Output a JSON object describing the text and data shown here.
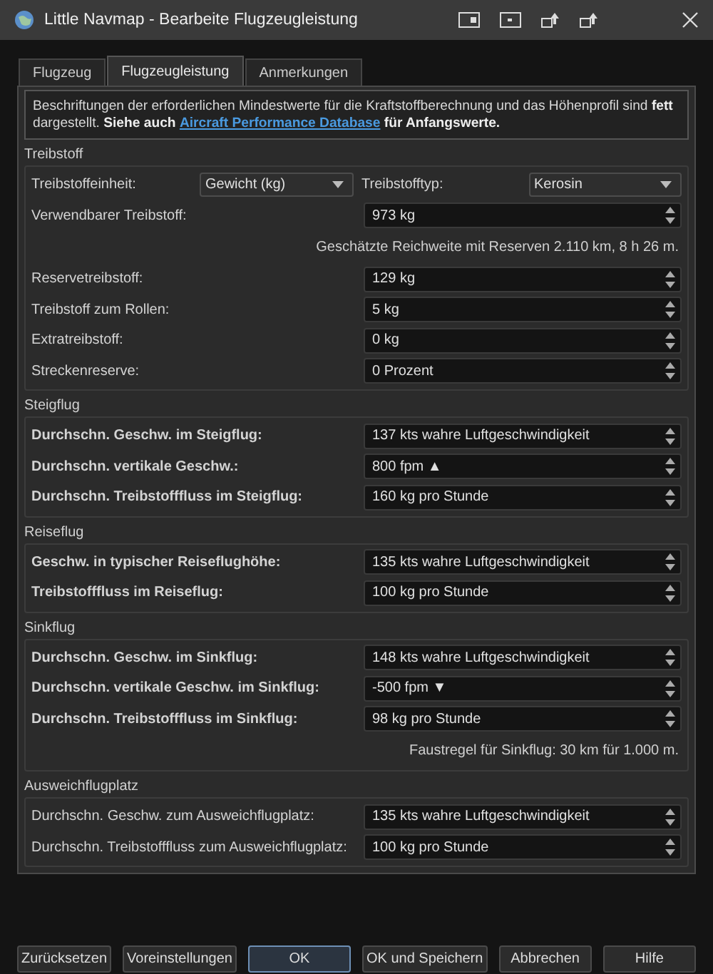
{
  "window": {
    "title": "Little Navmap - Bearbeite Flugzeugleistung"
  },
  "tabs": [
    {
      "label": "Flugzeug",
      "selected": false
    },
    {
      "label": "Flugzeugleistung",
      "selected": true
    },
    {
      "label": "Anmerkungen",
      "selected": false
    }
  ],
  "info": {
    "before": "Beschriftungen der erforderlichen Mindestwerte für die Kraftstoffberechnung und das Höhenprofil sind **fett** dargestellt. **Siehe auch**",
    "link": "Aircraft Performance Database",
    "after": "**für Anfangswerte.**"
  },
  "groups": [
    {
      "title": "Treibstoff",
      "rows": [
        {
          "kind": "combo-pair",
          "label": "Treibstoffeinheit:",
          "value": "Gewicht (kg)",
          "label2": "Treibstofftyp:",
          "value2": "Kerosin"
        },
        {
          "kind": "spin",
          "label": "Verwendbarer Treibstoff:",
          "value": "973 kg",
          "bold": false
        },
        {
          "kind": "note",
          "text": "Geschätzte Reichweite mit Reserven 2.110 km, 8 h 26 m."
        },
        {
          "kind": "spin",
          "label": "Reservetreibstoff:",
          "value": "129 kg",
          "bold": false
        },
        {
          "kind": "spin",
          "label": "Treibstoff zum Rollen:",
          "value": "5 kg",
          "bold": false
        },
        {
          "kind": "spin",
          "label": "Extratreibstoff:",
          "value": "0 kg",
          "bold": false
        },
        {
          "kind": "spin",
          "label": "Streckenreserve:",
          "value": "0 Prozent",
          "bold": false
        }
      ]
    },
    {
      "title": "Steigflug",
      "rows": [
        {
          "kind": "spin",
          "label": "Durchschn. Geschw. im Steigflug:",
          "value": "137 kts wahre Luftgeschwindigkeit",
          "bold": true
        },
        {
          "kind": "spin",
          "label": "Durchschn. vertikale Geschw.:",
          "value": "800 fpm ▲",
          "bold": true
        },
        {
          "kind": "spin",
          "label": "Durchschn. Treibstofffluss im Steigflug:",
          "value": "160 kg pro Stunde",
          "bold": true
        }
      ]
    },
    {
      "title": "Reiseflug",
      "rows": [
        {
          "kind": "spin",
          "label": "Geschw. in typischer Reiseflughöhe:",
          "value": "135 kts wahre Luftgeschwindigkeit",
          "bold": true
        },
        {
          "kind": "spin",
          "label": "Treibstofffluss im Reiseflug:",
          "value": "100 kg pro Stunde",
          "bold": true
        }
      ]
    },
    {
      "title": "Sinkflug",
      "rows": [
        {
          "kind": "spin",
          "label": "Durchschn. Geschw. im Sinkflug:",
          "value": "148 kts wahre Luftgeschwindigkeit",
          "bold": true
        },
        {
          "kind": "spin",
          "label": "Durchschn. vertikale Geschw. im Sinkflug:",
          "value": "-500 fpm ▼",
          "bold": true
        },
        {
          "kind": "spin",
          "label": "Durchschn. Treibstofffluss im Sinkflug:",
          "value": "98 kg pro Stunde",
          "bold": true
        },
        {
          "kind": "note",
          "text": "Faustregel für Sinkflug: 30 km für 1.000 m."
        }
      ]
    },
    {
      "title": "Ausweichflugplatz",
      "rows": [
        {
          "kind": "spin",
          "label": "Durchschn. Geschw. zum Ausweichflugplatz:",
          "value": "135 kts wahre Luftgeschwindigkeit",
          "bold": false
        },
        {
          "kind": "spin",
          "label": "Durchschn. Treibstofffluss zum Ausweichflugplatz:",
          "value": "100 kg pro Stunde",
          "bold": false
        }
      ]
    }
  ],
  "buttons": [
    {
      "label": "Zurücksetzen",
      "default": false
    },
    {
      "label": "Voreinstellungen",
      "default": false
    },
    {
      "label": "OK",
      "default": true
    },
    {
      "label": "OK und Speichern",
      "default": false
    },
    {
      "label": "Abbrechen",
      "default": false
    },
    {
      "label": "Hilfe",
      "default": false
    }
  ]
}
